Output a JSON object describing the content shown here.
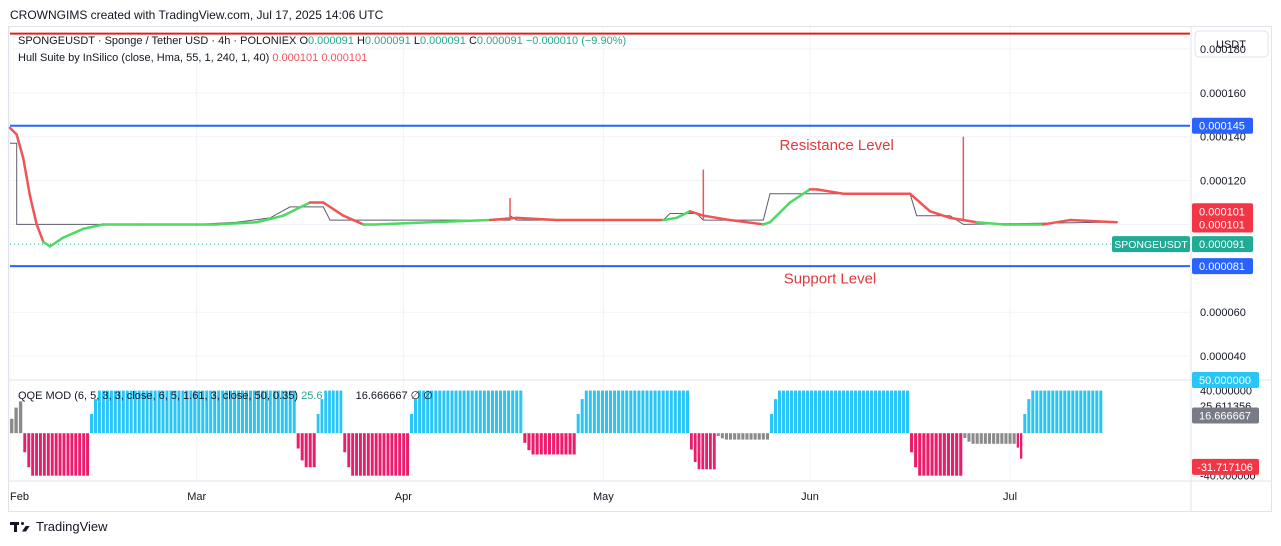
{
  "header": {
    "text": "CROWNGIMS created with TradingView.com, Jul 17, 2025 14:06 UTC"
  },
  "legend": {
    "symbol_line": "SPONGEUSDT · Sponge / Tether USD · 4h · POLONIEX",
    "o_label": "O",
    "o_value": "0.000091",
    "h_label": "H",
    "h_value": "0.000091",
    "l_label": "L",
    "l_value": "0.000091",
    "c_label": "C",
    "c_value": "0.000091",
    "change": "−0.000010 (−9.90%)",
    "indicator": "Hull Suite by InSilico (close, Hma, 55, 1, 240, 1, 40)",
    "indicator_v1": "0.000101",
    "indicator_v2": "0.000101"
  },
  "qqe_legend": {
    "label": "QQE MOD (6, 5, 3, 3, close, 6, 5, 1.61, 3, close, 50, 0.35)",
    "v1": "25.6",
    "v2": "16.666667",
    "v3": "∅",
    "v4": "∅"
  },
  "footer": {
    "brand": "TradingView"
  },
  "colors": {
    "hull_up": "#4cd964",
    "hull_down": "#f05454",
    "qqe_blue": "#29c5f6",
    "qqe_pink": "#ec1c6c",
    "qqe_grey": "#8b8b8b",
    "resistance_line": "#e0201b",
    "level_line": "#2962ff",
    "annotation": "#e03a3e",
    "price_tag": "#22ab94",
    "red_tag": "#f23645"
  },
  "chart_data": [
    {
      "type": "line",
      "title": "SPONGEUSDT · Sponge / Tether USD · 4h · POLONIEX",
      "currency": "USDT",
      "x_ticks": [
        "Feb",
        "Mar",
        "Apr",
        "May",
        "Jun",
        "Jul"
      ],
      "x_tick_dates": [
        "2025-02-01",
        "2025-03-01",
        "2025-04-01",
        "2025-05-01",
        "2025-06-01",
        "2025-07-01"
      ],
      "x_range": [
        "2025-02-01",
        "2025-07-28"
      ],
      "ylim": [
        3e-05,
        0.00019
      ],
      "y_ticks": [
        {
          "value": 0.00018,
          "label": "0.000180"
        },
        {
          "value": 0.00016,
          "label": "0.000160"
        },
        {
          "value": 0.00014,
          "label": "0.000140"
        },
        {
          "value": 0.00012,
          "label": "0.000120"
        },
        {
          "value": 6e-05,
          "label": "0.000060"
        },
        {
          "value": 4e-05,
          "label": "0.000040"
        }
      ],
      "price_series": [
        [
          "2025-02-01",
          0.000137
        ],
        [
          "2025-02-02",
          0.000137
        ],
        [
          "2025-02-02",
          0.0001
        ],
        [
          "2025-03-01",
          0.0001
        ],
        [
          "2025-03-07",
          0.000101
        ],
        [
          "2025-03-12",
          0.000103
        ],
        [
          "2025-03-15",
          0.000108
        ],
        [
          "2025-03-20",
          0.000108
        ],
        [
          "2025-03-21",
          0.000102
        ],
        [
          "2025-04-17",
          0.000102
        ],
        [
          "2025-04-17",
          0.000104
        ],
        [
          "2025-04-18",
          0.000102
        ],
        [
          "2025-05-10",
          0.000102
        ],
        [
          "2025-05-11",
          0.000105
        ],
        [
          "2025-05-15",
          0.000105
        ],
        [
          "2025-05-16",
          0.000102
        ],
        [
          "2025-05-25",
          0.000102
        ],
        [
          "2025-05-26",
          0.000114
        ],
        [
          "2025-06-16",
          0.000114
        ],
        [
          "2025-06-17",
          0.000104
        ],
        [
          "2025-06-22",
          0.000104
        ],
        [
          "2025-06-24",
          0.0001
        ],
        [
          "2025-07-15",
          0.000101
        ]
      ],
      "spikes": [
        {
          "date": "2025-04-17",
          "high": 0.000112
        },
        {
          "date": "2025-05-16",
          "high": 0.000125
        },
        {
          "date": "2025-06-24",
          "high": 0.00014
        }
      ],
      "hull_series": [
        {
          "x": "2025-02-01",
          "y": 0.000144,
          "trend": "down"
        },
        {
          "x": "2025-02-02",
          "y": 0.000141,
          "trend": "down"
        },
        {
          "x": "2025-02-03",
          "y": 0.00013,
          "trend": "down"
        },
        {
          "x": "2025-02-04",
          "y": 0.000113,
          "trend": "down"
        },
        {
          "x": "2025-02-05",
          "y": 0.0001,
          "trend": "down"
        },
        {
          "x": "2025-02-06",
          "y": 9.2e-05,
          "trend": "down"
        },
        {
          "x": "2025-02-07",
          "y": 9e-05,
          "trend": "up"
        },
        {
          "x": "2025-02-09",
          "y": 9.4e-05,
          "trend": "up"
        },
        {
          "x": "2025-02-12",
          "y": 9.8e-05,
          "trend": "up"
        },
        {
          "x": "2025-02-15",
          "y": 0.0001,
          "trend": "up"
        },
        {
          "x": "2025-02-20",
          "y": 0.0001,
          "trend": "up"
        },
        {
          "x": "2025-03-01",
          "y": 0.0001,
          "trend": "up"
        },
        {
          "x": "2025-03-04",
          "y": 0.0001,
          "trend": "up"
        },
        {
          "x": "2025-03-10",
          "y": 0.000101,
          "trend": "up"
        },
        {
          "x": "2025-03-14",
          "y": 0.000104,
          "trend": "up"
        },
        {
          "x": "2025-03-18",
          "y": 0.00011,
          "trend": "up"
        },
        {
          "x": "2025-03-20",
          "y": 0.00011,
          "trend": "down"
        },
        {
          "x": "2025-03-23",
          "y": 0.000104,
          "trend": "down"
        },
        {
          "x": "2025-03-26",
          "y": 0.0001,
          "trend": "down"
        },
        {
          "x": "2025-03-28",
          "y": 0.0001,
          "trend": "up"
        },
        {
          "x": "2025-04-05",
          "y": 0.000101,
          "trend": "up"
        },
        {
          "x": "2025-04-14",
          "y": 0.000102,
          "trend": "up"
        },
        {
          "x": "2025-04-18",
          "y": 0.000103,
          "trend": "down"
        },
        {
          "x": "2025-04-24",
          "y": 0.000102,
          "trend": "down"
        },
        {
          "x": "2025-05-01",
          "y": 0.000102,
          "trend": "down"
        },
        {
          "x": "2025-05-10",
          "y": 0.000102,
          "trend": "down"
        },
        {
          "x": "2025-05-12",
          "y": 0.000103,
          "trend": "up"
        },
        {
          "x": "2025-05-14",
          "y": 0.000106,
          "trend": "up"
        },
        {
          "x": "2025-05-16",
          "y": 0.000104,
          "trend": "down"
        },
        {
          "x": "2025-05-20",
          "y": 0.000102,
          "trend": "down"
        },
        {
          "x": "2025-05-25",
          "y": 0.0001,
          "trend": "down"
        },
        {
          "x": "2025-05-26",
          "y": 0.000101,
          "trend": "up"
        },
        {
          "x": "2025-05-29",
          "y": 0.00011,
          "trend": "up"
        },
        {
          "x": "2025-06-01",
          "y": 0.000116,
          "trend": "up"
        },
        {
          "x": "2025-06-02",
          "y": 0.000116,
          "trend": "down"
        },
        {
          "x": "2025-06-06",
          "y": 0.000114,
          "trend": "down"
        },
        {
          "x": "2025-06-16",
          "y": 0.000114,
          "trend": "down"
        },
        {
          "x": "2025-06-19",
          "y": 0.000106,
          "trend": "down"
        },
        {
          "x": "2025-06-22",
          "y": 0.000103,
          "trend": "down"
        },
        {
          "x": "2025-06-26",
          "y": 0.000101,
          "trend": "down"
        },
        {
          "x": "2025-06-30",
          "y": 0.0001,
          "trend": "up"
        },
        {
          "x": "2025-07-06",
          "y": 0.0001,
          "trend": "up"
        },
        {
          "x": "2025-07-10",
          "y": 0.000102,
          "trend": "down"
        },
        {
          "x": "2025-07-17",
          "y": 0.000101,
          "trend": "down"
        }
      ],
      "horizontal_lines": [
        {
          "name": "top-red-line",
          "value": 0.000187,
          "color": "#e0201b"
        },
        {
          "name": "resistance-line",
          "value": 0.000145,
          "color": "#2962ff"
        },
        {
          "name": "support-line",
          "value": 8.1e-05,
          "color": "#2962ff"
        }
      ],
      "annotations": [
        {
          "text": "Resistance Level",
          "x": "2025-06-05",
          "y": 0.000134
        },
        {
          "text": "Support Level",
          "x": "2025-06-04",
          "y": 7.3e-05
        }
      ],
      "last_price": 9.1e-05,
      "price_tags": [
        {
          "label": "0.000145",
          "value": 0.000145,
          "color": "#2962ff"
        },
        {
          "label": "0.000101",
          "value": 0.000106,
          "color": "#f23645"
        },
        {
          "label": "0.000101",
          "value": 0.0001,
          "color": "#f23645"
        },
        {
          "label": "0.000091",
          "value": 9.1e-05,
          "color": "#22ab94",
          "symbol": "SPONGEUSDT"
        },
        {
          "label": "0.000081",
          "value": 8.1e-05,
          "color": "#2962ff"
        }
      ]
    },
    {
      "type": "bar",
      "title": "QQE MOD (6, 5, 3, 3, close, 6, 5, 1.61, 3, close, 50, 0.35)",
      "ylim": [
        -45,
        50
      ],
      "y_ticks": [
        {
          "value": 40,
          "label": "40.000000"
        },
        {
          "value": 25.611356,
          "label": "25.611356"
        },
        {
          "value": -40,
          "label": "-40.000000"
        }
      ],
      "tags": [
        {
          "label": "50.000000",
          "value": 50,
          "color": "#29c5f6"
        },
        {
          "label": "16.666667",
          "value": 16.666667,
          "color": "#787b86"
        },
        {
          "label": "-31.717106",
          "value": -31.717106,
          "color": "#f23645"
        }
      ],
      "segments": [
        {
          "start": "2025-02-01",
          "end": "2025-02-03",
          "value": 30,
          "color": "grey"
        },
        {
          "start": "2025-02-03",
          "end": "2025-02-13",
          "value": -40,
          "color": "pink"
        },
        {
          "start": "2025-02-13",
          "end": "2025-03-16",
          "value": 40,
          "color": "blue"
        },
        {
          "start": "2025-03-16",
          "end": "2025-03-19",
          "value": -32,
          "color": "pink"
        },
        {
          "start": "2025-03-19",
          "end": "2025-03-23",
          "value": 40,
          "color": "blue"
        },
        {
          "start": "2025-03-23",
          "end": "2025-04-02",
          "value": -40,
          "color": "pink"
        },
        {
          "start": "2025-04-02",
          "end": "2025-04-19",
          "value": 40,
          "color": "blue"
        },
        {
          "start": "2025-04-19",
          "end": "2025-04-27",
          "value": -20,
          "color": "pink"
        },
        {
          "start": "2025-04-27",
          "end": "2025-05-14",
          "value": 40,
          "color": "blue"
        },
        {
          "start": "2025-05-14",
          "end": "2025-05-18",
          "value": -34,
          "color": "pink"
        },
        {
          "start": "2025-05-18",
          "end": "2025-05-26",
          "value": -6,
          "color": "grey"
        },
        {
          "start": "2025-05-26",
          "end": "2025-06-16",
          "value": 40,
          "color": "blue"
        },
        {
          "start": "2025-06-16",
          "end": "2025-06-24",
          "value": -40,
          "color": "pink"
        },
        {
          "start": "2025-06-24",
          "end": "2025-07-02",
          "value": -10,
          "color": "grey"
        },
        {
          "start": "2025-07-02",
          "end": "2025-07-03",
          "value": -30,
          "color": "pink"
        },
        {
          "start": "2025-07-03",
          "end": "2025-07-15",
          "value": 40,
          "color": "blue"
        }
      ]
    }
  ]
}
